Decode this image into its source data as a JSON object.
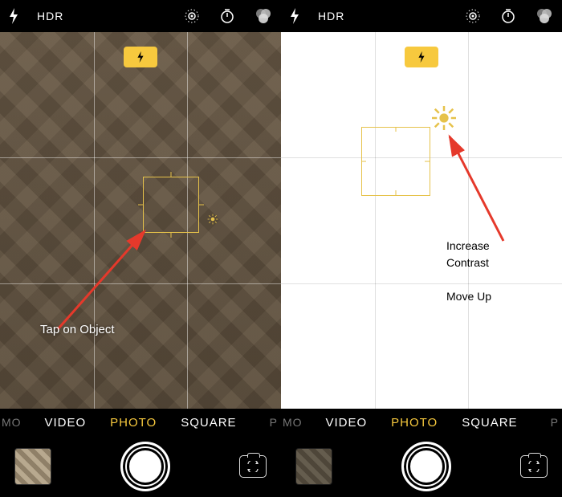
{
  "left": {
    "topbar": {
      "hdr": "HDR"
    },
    "flash_badge": true,
    "annotation": "Tap on Object",
    "modes": {
      "edge_left": "MO",
      "items": [
        "VIDEO",
        "PHOTO",
        "SQUARE"
      ],
      "active_index": 1,
      "edge_right": "P"
    }
  },
  "right": {
    "topbar": {
      "hdr": "HDR"
    },
    "flash_badge": true,
    "annotation_line1": "Increase",
    "annotation_line2": "Contrast",
    "annotation_line3": "Move Up",
    "modes": {
      "edge_left": "MO",
      "items": [
        "VIDEO",
        "PHOTO",
        "SQUARE"
      ],
      "active_index": 1,
      "edge_right": "P"
    }
  },
  "icons": {
    "flash": "flash-icon",
    "liveph": "live-photo-icon",
    "timer": "timer-icon",
    "filters": "filters-icon",
    "bolt": "bolt-icon",
    "sun": "sun-icon",
    "switch": "switch-camera-icon"
  },
  "colors": {
    "accent": "#f7c93e",
    "focus": "#e6c24a",
    "arrow": "#e5392b"
  }
}
